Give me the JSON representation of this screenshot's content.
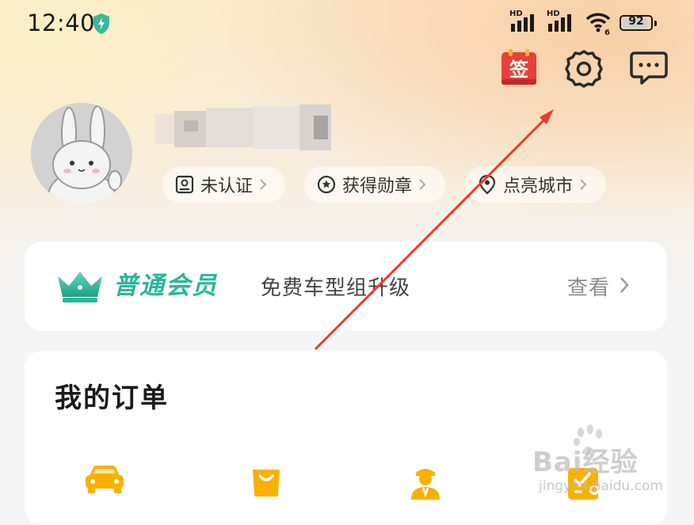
{
  "status_bar": {
    "time": "12:40",
    "network1": "HD",
    "network2": "HD",
    "wifi_tag": "6",
    "battery": "92",
    "battery_level": 0.92
  },
  "header_icons": {
    "sign_in": "签"
  },
  "profile": {
    "badges": [
      {
        "label": "未认证",
        "icon": "id-card-icon"
      },
      {
        "label": "获得勋章",
        "icon": "medal-icon"
      },
      {
        "label": "点亮城市",
        "icon": "location-pin-icon"
      }
    ]
  },
  "member_card": {
    "title": "普通会员",
    "description": "免费车型组升级",
    "link": "查看"
  },
  "orders": {
    "title": "我的订单",
    "icons": [
      "car-icon",
      "shopping-bag-icon",
      "driver-icon",
      "checklist-icon"
    ]
  },
  "colors": {
    "accent_teal": "#2bb59c",
    "order_icon_orange": "#fbb000",
    "sign_red": "#e8403a",
    "arrow_red": "#ee3a2c"
  },
  "watermark": {
    "text": "Bai经验",
    "sub": "jingyan.baidu.com"
  }
}
